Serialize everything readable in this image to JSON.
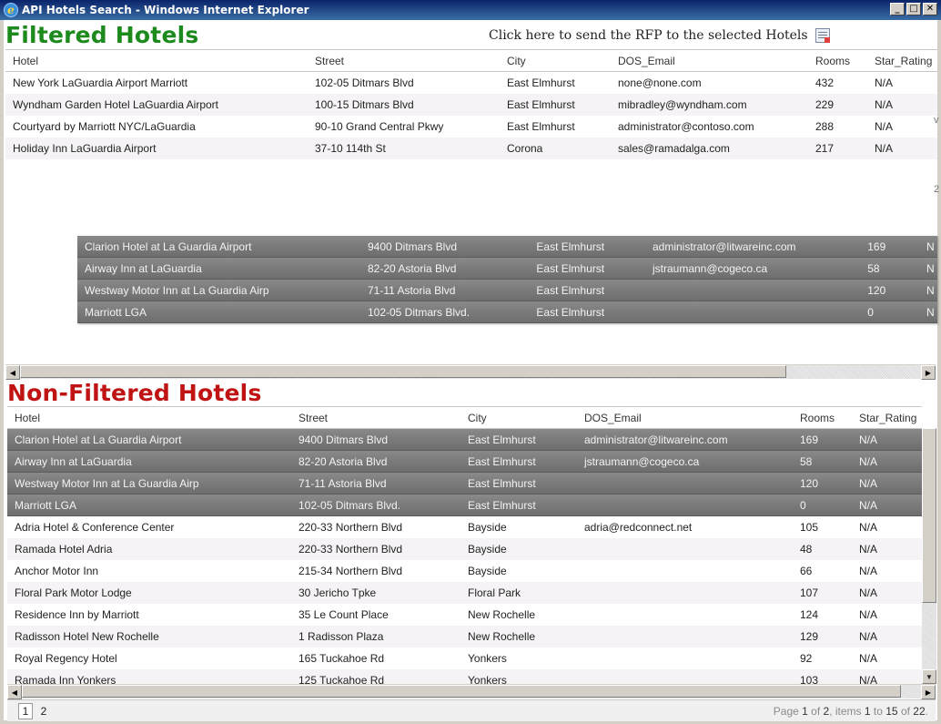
{
  "window": {
    "title": "API Hotels Search - Windows Internet Explorer",
    "buttons": [
      "_",
      "□",
      "✕"
    ]
  },
  "filtered": {
    "title": "Filtered Hotels",
    "rfp_link": "Click here to send the RFP to the selected Hotels",
    "columns": [
      "Hotel",
      "Street",
      "City",
      "DOS_Email",
      "Rooms",
      "Star_Rating"
    ],
    "rows": [
      [
        "New York LaGuardia Airport Marriott",
        "102-05 Ditmars Blvd",
        "East Elmhurst",
        "none@none.com",
        "432",
        "N/A"
      ],
      [
        "Wyndham Garden Hotel LaGuardia Airport",
        "100-15 Ditmars Blvd",
        "East Elmhurst",
        "mibradley@wyndham.com",
        "229",
        "N/A"
      ],
      [
        "Courtyard by Marriott NYC/LaGuardia",
        "90-10 Grand Central Pkwy",
        "East Elmhurst",
        "administrator@contoso.com",
        "288",
        "N/A"
      ],
      [
        "Holiday Inn LaGuardia Airport",
        "37-10 114th St",
        "Corona",
        "sales@ramadalga.com",
        "217",
        "N/A"
      ]
    ],
    "dragged_rows": [
      [
        "Clarion Hotel at La Guardia Airport",
        "9400 Ditmars Blvd",
        "East Elmhurst",
        "administrator@litwareinc.com",
        "169",
        "N"
      ],
      [
        "Airway Inn at LaGuardia",
        "82-20 Astoria Blvd",
        "East Elmhurst",
        "jstraumann@cogeco.ca",
        "58",
        "N"
      ],
      [
        "Westway Motor Inn at La Guardia Airp",
        "71-11 Astoria Blvd",
        "East Elmhurst",
        "",
        "120",
        "N"
      ],
      [
        "Marriott LGA",
        "102-05 Ditmars Blvd.",
        "East Elmhurst",
        "",
        "0",
        "N"
      ]
    ]
  },
  "nonfiltered": {
    "title": "Non-Filtered Hotels",
    "columns": [
      "Hotel",
      "Street",
      "City",
      "DOS_Email",
      "Rooms",
      "Star_Rating"
    ],
    "selected_rows": [
      [
        "Clarion Hotel at La Guardia Airport",
        "9400 Ditmars Blvd",
        "East Elmhurst",
        "administrator@litwareinc.com",
        "169",
        "N/A"
      ],
      [
        "Airway Inn at LaGuardia",
        "82-20 Astoria Blvd",
        "East Elmhurst",
        "jstraumann@cogeco.ca",
        "58",
        "N/A"
      ],
      [
        "Westway Motor Inn at La Guardia Airp",
        "71-11 Astoria Blvd",
        "East Elmhurst",
        "",
        "120",
        "N/A"
      ],
      [
        "Marriott LGA",
        "102-05 Ditmars Blvd.",
        "East Elmhurst",
        "",
        "0",
        "N/A"
      ]
    ],
    "rows": [
      [
        "Adria Hotel & Conference Center",
        "220-33 Northern Blvd",
        "Bayside",
        "adria@redconnect.net",
        "105",
        "N/A"
      ],
      [
        "Ramada Hotel Adria",
        "220-33 Northern Blvd",
        "Bayside",
        "",
        "48",
        "N/A"
      ],
      [
        "Anchor Motor Inn",
        "215-34 Northern Blvd",
        "Bayside",
        "",
        "66",
        "N/A"
      ],
      [
        "Floral Park Motor Lodge",
        "30 Jericho Tpke",
        "Floral Park",
        "",
        "107",
        "N/A"
      ],
      [
        "Residence Inn by Marriott",
        "35 Le Count Place",
        "New Rochelle",
        "",
        "124",
        "N/A"
      ],
      [
        "Radisson Hotel New Rochelle",
        "1 Radisson Plaza",
        "New Rochelle",
        "",
        "129",
        "N/A"
      ],
      [
        "Royal Regency Hotel",
        "165 Tuckahoe Rd",
        "Yonkers",
        "",
        "92",
        "N/A"
      ],
      [
        "Ramada Inn Yonkers",
        "125 Tuckahoe Rd",
        "Yonkers",
        "",
        "103",
        "N/A"
      ]
    ],
    "pager": {
      "pages": [
        "1",
        "2"
      ],
      "current": "1",
      "info_prefix": "Page ",
      "page_num": "1",
      "page_of": " of ",
      "page_total": "2",
      "items_label": ", items ",
      "items_from": "1",
      "items_to_label": " to ",
      "items_to": "15",
      "items_of": " of ",
      "items_total": "22",
      "info_suffix": "."
    }
  },
  "stray_marks": [
    "v",
    "2"
  ]
}
